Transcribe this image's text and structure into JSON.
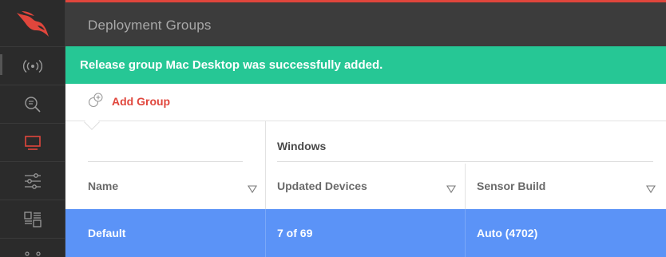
{
  "page": {
    "title": "Deployment Groups"
  },
  "sidebar": {
    "logo_icon": "falcon-logo-icon",
    "items": [
      {
        "name": "sidebar-item-activity",
        "icon": "broadcast-icon"
      },
      {
        "name": "sidebar-item-investigate",
        "icon": "search-icon"
      },
      {
        "name": "sidebar-item-hosts",
        "icon": "monitor-icon",
        "active": true
      },
      {
        "name": "sidebar-item-configuration",
        "icon": "sliders-icon"
      },
      {
        "name": "sidebar-item-dashboards",
        "icon": "dashboard-icon"
      },
      {
        "name": "sidebar-item-more",
        "icon": "dots-icon"
      }
    ]
  },
  "banner": {
    "message": "Release group Mac Desktop was successfully added."
  },
  "toolbar": {
    "add_group_label": "Add Group"
  },
  "table": {
    "group_header": "Windows",
    "columns": {
      "name": "Name",
      "updated_devices": "Updated Devices",
      "sensor_build": "Sensor Build"
    },
    "rows": [
      {
        "name": "Default",
        "updated_devices": "7 of 69",
        "sensor_build": "Auto (4702)"
      }
    ]
  },
  "colors": {
    "accent": "#e0463c",
    "success": "#26c795",
    "selected_row": "#5b93f7",
    "sidebar_bg": "#2b2b2b",
    "topbar_bg": "#3c3c3c"
  }
}
